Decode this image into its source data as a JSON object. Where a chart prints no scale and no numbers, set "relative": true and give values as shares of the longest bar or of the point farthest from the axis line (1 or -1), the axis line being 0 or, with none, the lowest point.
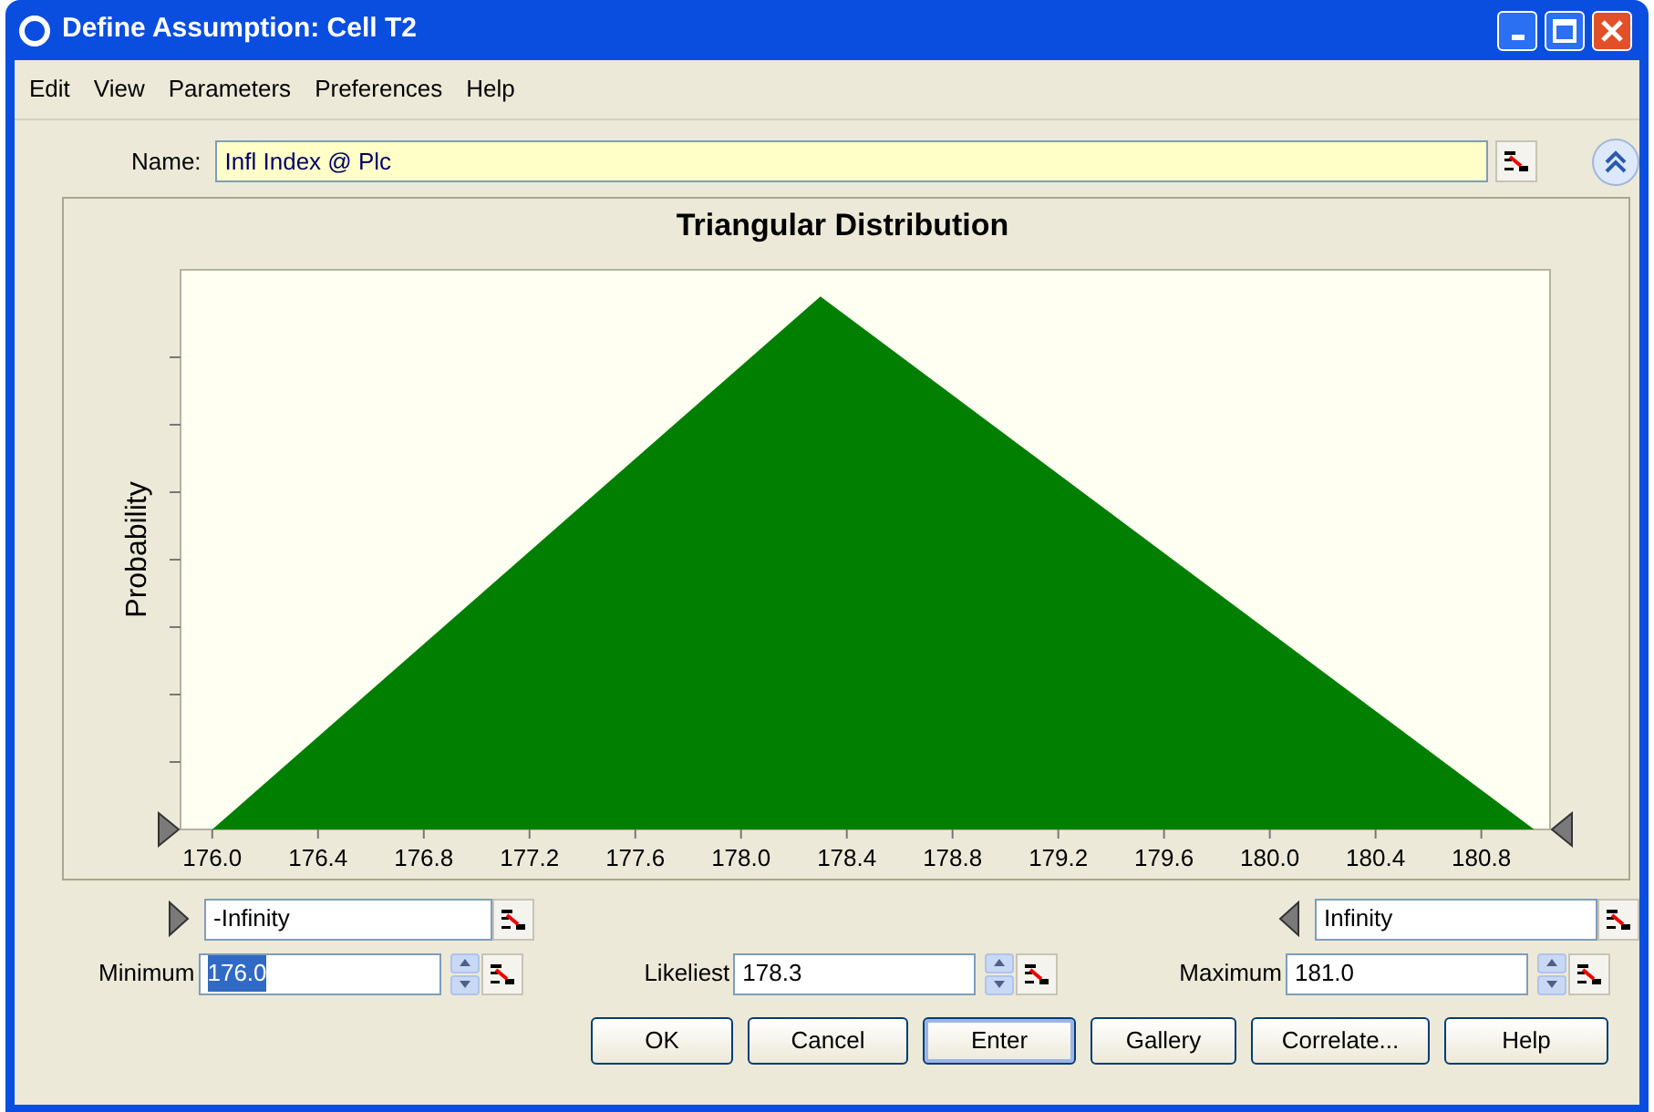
{
  "window": {
    "title": "Define Assumption: Cell T2"
  },
  "menu": [
    "Edit",
    "View",
    "Parameters",
    "Preferences",
    "Help"
  ],
  "name_field": {
    "label": "Name:",
    "value": "Infl Index @ Plc"
  },
  "chart": {
    "chart_data": {
      "type": "area",
      "title": "Triangular Distribution",
      "ylabel": "Probability",
      "relative": true,
      "xlim": [
        175.88,
        181.06
      ],
      "xticks": [
        {
          "value": 176.0,
          "label": "176.0"
        },
        {
          "value": 176.4,
          "label": "176.4"
        },
        {
          "value": 176.8,
          "label": "176.8"
        },
        {
          "value": 177.2,
          "label": "177.2"
        },
        {
          "value": 177.6,
          "label": "177.6"
        },
        {
          "value": 178.0,
          "label": "178.0"
        },
        {
          "value": 178.4,
          "label": "178.4"
        },
        {
          "value": 178.8,
          "label": "178.8"
        },
        {
          "value": 179.2,
          "label": "179.2"
        },
        {
          "value": 179.6,
          "label": "179.6"
        },
        {
          "value": 180.0,
          "label": "180.0"
        },
        {
          "value": 180.4,
          "label": "180.4"
        },
        {
          "value": 180.8,
          "label": "180.8"
        }
      ],
      "x": [
        176.0,
        178.3,
        181.0
      ],
      "series": [
        {
          "color": "#007f00",
          "values": [
            0,
            1,
            0
          ]
        }
      ]
    }
  },
  "bounds": {
    "lower": "-Infinity",
    "upper": "Infinity"
  },
  "parameters": [
    {
      "label": "Minimum",
      "value": "176.0",
      "text_selected": true
    },
    {
      "label": "Likeliest",
      "value": "178.3",
      "text_selected": false
    },
    {
      "label": "Maximum",
      "value": "181.0",
      "text_selected": false
    }
  ],
  "buttons": [
    {
      "label": "OK",
      "default": false
    },
    {
      "label": "Cancel",
      "default": false
    },
    {
      "label": "Enter",
      "default": true
    },
    {
      "label": "Gallery",
      "default": false
    },
    {
      "label": "Correlate...",
      "default": false
    },
    {
      "label": "Help",
      "default": false
    }
  ]
}
